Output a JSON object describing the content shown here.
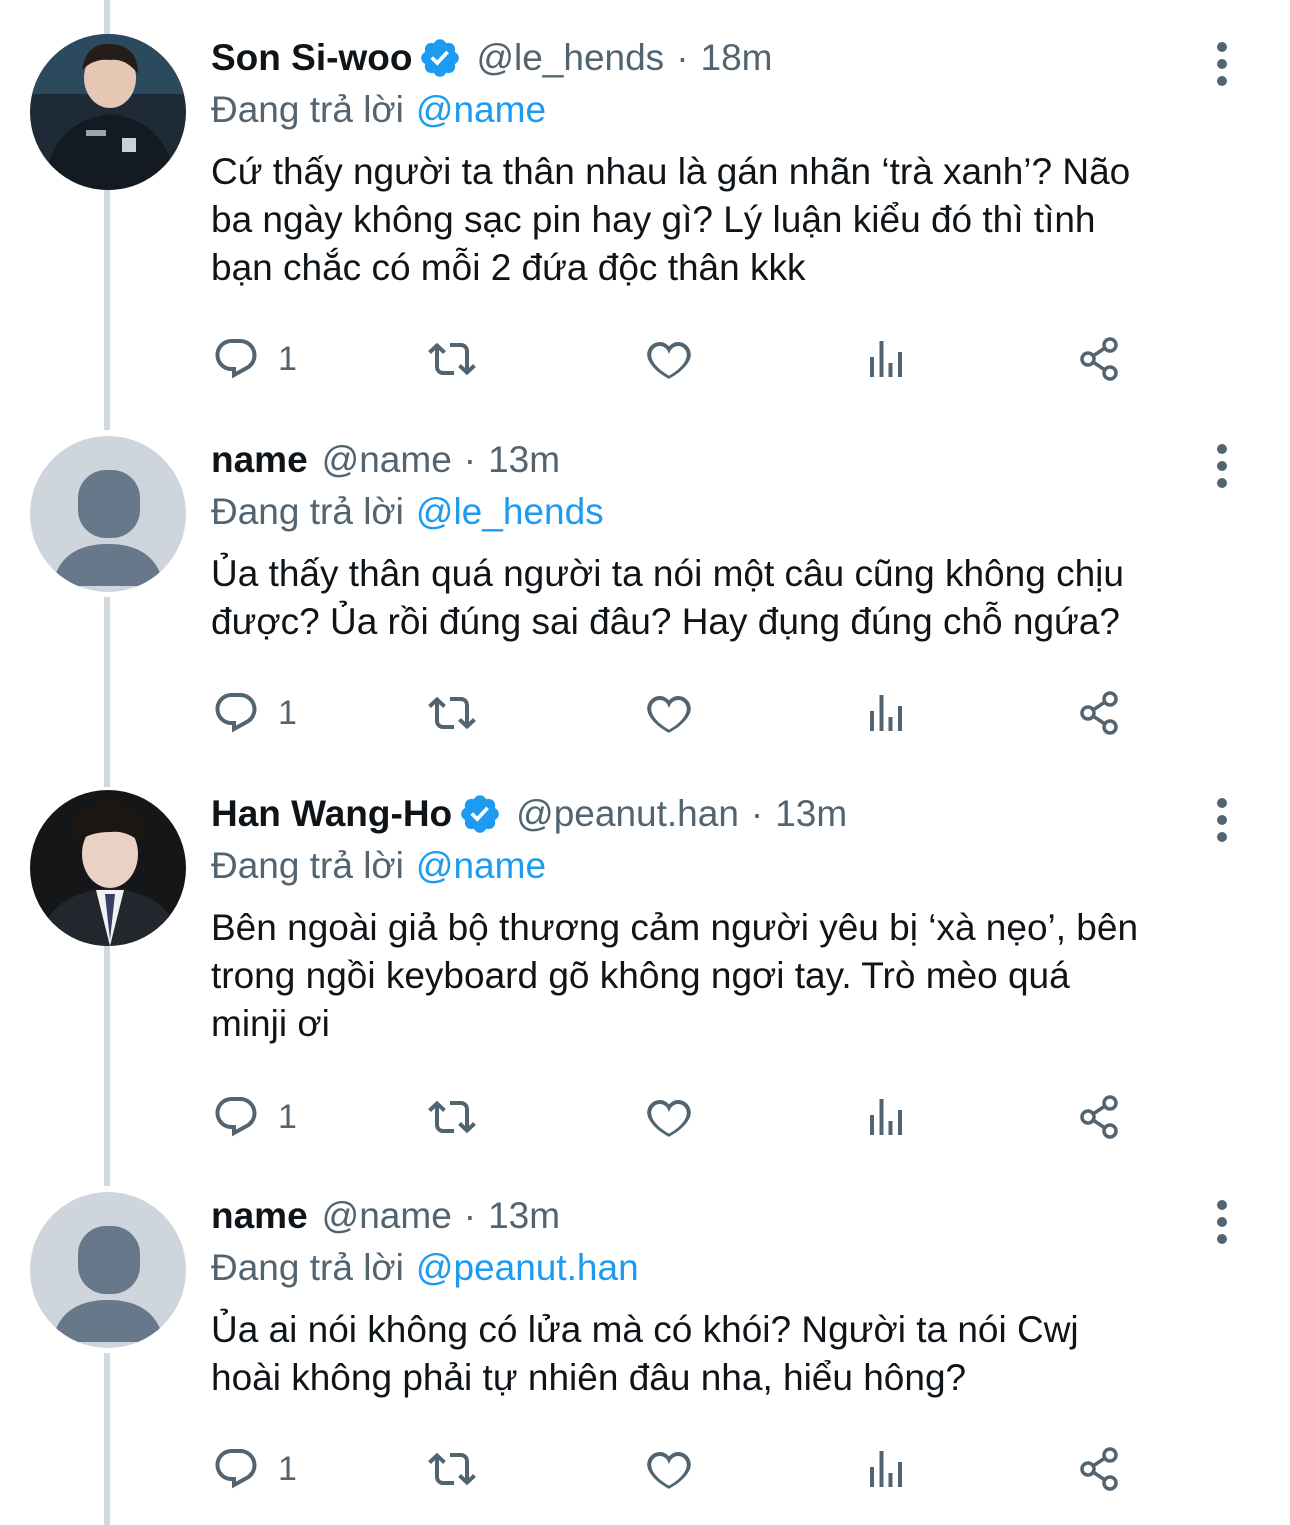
{
  "tweets": [
    {
      "name": "Son Si-woo",
      "verified": true,
      "handle": "@le_hends",
      "separator": "·",
      "time": "18m",
      "reply_prefix": "Đang trả lời",
      "reply_to": "@name",
      "text": "Cứ thấy người ta thân nhau là gán nhãn ‘trà xanh’? Não\nba ngày không sạc pin hay gì? Lý luận kiểu đó thì tình\nbạn chắc có mỗi 2 đứa độc thân kkk",
      "reply_count": "1"
    },
    {
      "name": "name",
      "verified": false,
      "handle": "@name",
      "separator": "·",
      "time": "13m",
      "reply_prefix": "Đang trả lời",
      "reply_to": "@le_hends",
      "text": "Ủa thấy thân quá người ta nói một câu cũng không chịu\nđược? Ủa rồi đúng sai đâu? Hay đụng đúng chỗ ngứa?",
      "reply_count": "1"
    },
    {
      "name": "Han Wang-Ho",
      "verified": true,
      "handle": "@peanut.han",
      "separator": "·",
      "time": "13m",
      "reply_prefix": "Đang trả lời",
      "reply_to": "@name",
      "text": "Bên ngoài giả bộ thương cảm người yêu bị ‘xà nẹo’, bên\ntrong ngồi keyboard gõ không ngơi tay. Trò mèo quá\nminji ơi",
      "reply_count": "1"
    },
    {
      "name": "name",
      "verified": false,
      "handle": "@name",
      "separator": "·",
      "time": "13m",
      "reply_prefix": "Đang trả lời",
      "reply_to": "@peanut.han",
      "text": "Ủa ai nói không có lửa mà có khói? Người ta nói Cwj\nhoài không phải tự nhiên đâu nha, hiểu hông?",
      "reply_count": "1"
    }
  ],
  "colors": {
    "text": "#0f1419",
    "secondary": "#536471",
    "link": "#1d9bf0",
    "verified": "#1d9bf0",
    "thread_line": "#cfd9de",
    "default_avatar_bg": "#ced5dc",
    "default_avatar_fg": "#66788a"
  },
  "icons": {
    "reply": "speech-bubble-icon",
    "retweet": "retweet-icon",
    "like": "heart-icon",
    "views": "bar-chart-icon",
    "share": "share-icon",
    "more": "vertical-ellipsis-icon",
    "verified": "verified-badge-icon"
  }
}
